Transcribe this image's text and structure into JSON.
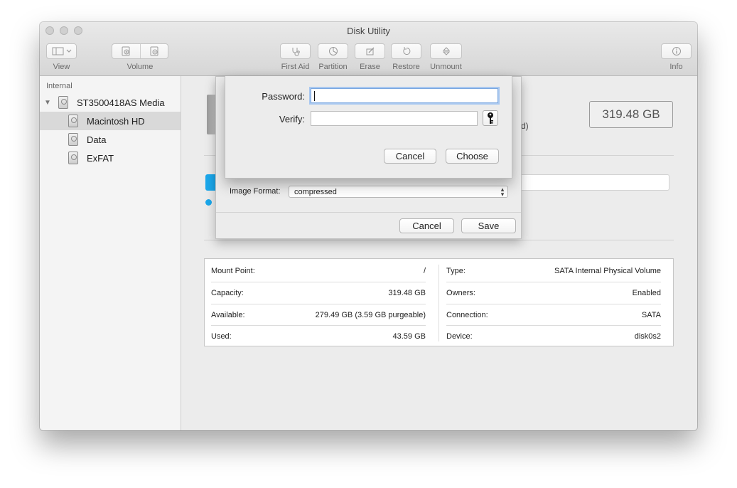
{
  "window": {
    "title": "Disk Utility"
  },
  "toolbar": {
    "view_label": "View",
    "volume_label": "Volume",
    "first_aid_label": "First Aid",
    "partition_label": "Partition",
    "erase_label": "Erase",
    "restore_label": "Restore",
    "unmount_label": "Unmount",
    "info_label": "Info"
  },
  "sidebar": {
    "header": "Internal",
    "items": [
      {
        "label": "ST3500418AS Media"
      },
      {
        "label": "Macintosh HD",
        "selected": true
      },
      {
        "label": "Data"
      },
      {
        "label": "ExFAT"
      }
    ]
  },
  "main": {
    "capacity": "319.48 GB",
    "partial_text": "d)",
    "info": {
      "left": [
        {
          "label": "Mount Point:",
          "value": "/"
        },
        {
          "label": "Capacity:",
          "value": "319.48 GB"
        },
        {
          "label": "Available:",
          "value": "279.49 GB (3.59 GB purgeable)"
        },
        {
          "label": "Used:",
          "value": "43.59 GB"
        }
      ],
      "right": [
        {
          "label": "Type:",
          "value": "SATA Internal Physical Volume"
        },
        {
          "label": "Owners:",
          "value": "Enabled"
        },
        {
          "label": "Connection:",
          "value": "SATA"
        },
        {
          "label": "Device:",
          "value": "disk0s2"
        }
      ]
    }
  },
  "save_sheet": {
    "image_format_label": "Image Format:",
    "image_format_value": "compressed",
    "cancel_label": "Cancel",
    "save_label": "Save"
  },
  "password_sheet": {
    "password_label": "Password:",
    "password_value": "",
    "verify_label": "Verify:",
    "verify_value": "",
    "cancel_label": "Cancel",
    "choose_label": "Choose"
  },
  "icons": {
    "view": "sidebar-toggle-icon",
    "add_volume": "add-volume-icon",
    "remove_volume": "remove-volume-icon",
    "first_aid": "stethoscope-icon",
    "partition": "pie-chart-icon",
    "erase": "erase-icon",
    "restore": "restore-icon",
    "unmount": "eject-icon",
    "info": "info-icon",
    "key": "key-icon"
  }
}
